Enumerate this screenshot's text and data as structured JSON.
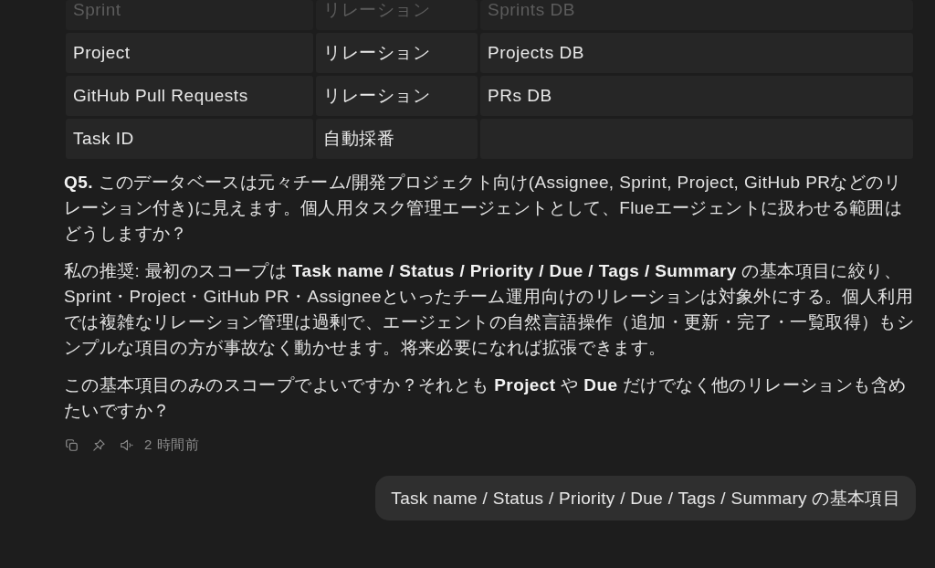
{
  "table": {
    "rows": [
      {
        "cells": [
          "Sprint",
          "リレーション",
          "Sprints DB"
        ],
        "partially_hidden": true
      },
      {
        "cells": [
          "Project",
          "リレーション",
          "Projects DB"
        ],
        "partially_hidden": false
      },
      {
        "cells": [
          "GitHub Pull Requests",
          "リレーション",
          "PRs DB"
        ],
        "partially_hidden": false
      },
      {
        "cells": [
          "Task ID",
          "自動採番"
        ],
        "partially_hidden": false
      }
    ]
  },
  "messages": [
    {
      "kind": "reply",
      "paragraphs": [
        "**Q5.** このデータベースは元々チーム/開発プロジェクト向け(Assignee, Sprint, Project, GitHub PRなどのリレーション付き)に見えます。個人用タスク管理エージェントとして、Flueエージェントに扱わせる範囲はどうしますか？",
        "私の推奨: 最初のスコープは **Task name / Status / Priority / Due / Tags / Summary** の基本項目に絞り、\nSprint・Project・GitHub PR・Assigneeといったチーム運用向けのリレーションは対象外にする。個人利用では複雑なリレーション管理は過剰で、エージェントの自然言語操作（追加・更新・完了・一覧取得）もシンプルな項目の方が事故なく動かせます。将来必要になれば拡張できます。",
        "この基本項目のみのスコープでよいですか？それとも **Project** や **Due** だけでなく他のリレーションも含めたいですか？"
      ],
      "time": "2 時間前"
    },
    {
      "kind": "bubble",
      "text": "Task name / Status / Priority / Due / Tags / Summary の基本項目"
    }
  ]
}
